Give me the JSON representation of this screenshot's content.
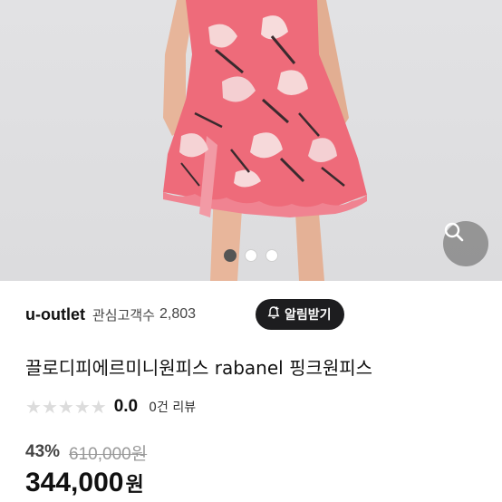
{
  "gallery": {
    "slide_count": 3,
    "active_index": 0,
    "zoom_icon": "search-icon"
  },
  "seller": {
    "name": "u-outlet",
    "interest_label": "관심고객수",
    "interest_count": "2,803",
    "alert_label": "알림받기",
    "alert_icon": "bell-plus-icon"
  },
  "product": {
    "title": "끌로디피에르미니원피스 rabanel 핑크원피스",
    "rating": "0.0",
    "rating_stars": 0,
    "review_count": "0건 리뷰",
    "discount": "43%",
    "original_price": "610,000원",
    "price": "344,000",
    "currency": "원"
  },
  "colors": {
    "dress_pink": "#ee6b7a",
    "alert_bg": "#1d1d1f",
    "star_empty": "#dcdcdc"
  }
}
